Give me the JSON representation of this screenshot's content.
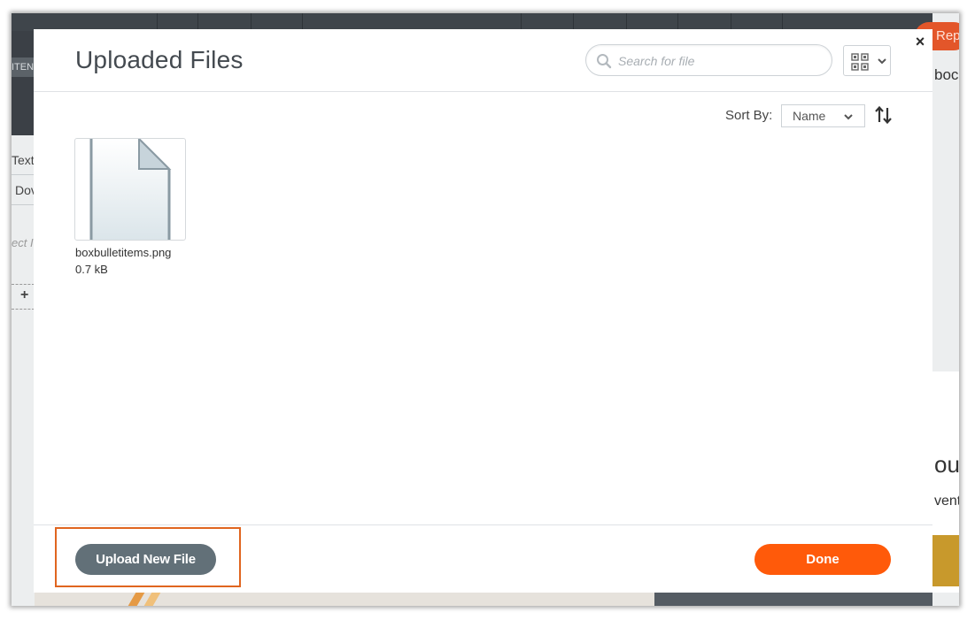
{
  "modal": {
    "title": "Uploaded Files",
    "close_label": "×",
    "search": {
      "placeholder": "Search for file",
      "value": ""
    },
    "view_toggle": {
      "icon": "grid-view-icon"
    },
    "sort": {
      "label": "Sort By:",
      "selected": "Name",
      "order_icon": "sort-order-icon"
    },
    "files": [
      {
        "name": "boxbulletitems.png",
        "size": "0.7 kB"
      }
    ],
    "footer": {
      "upload_label": "Upload New File",
      "done_label": "Done"
    }
  },
  "background": {
    "left_tab": "ITEN",
    "left_items": [
      "Text",
      "Dov",
      "ect I",
      "+"
    ],
    "right_button": "Rep",
    "right_texts": [
      "boc",
      "ou",
      "vent"
    ]
  },
  "colors": {
    "accent_orange": "#ff5a0a",
    "upload_gray": "#627078",
    "highlight": "#e0651f"
  }
}
